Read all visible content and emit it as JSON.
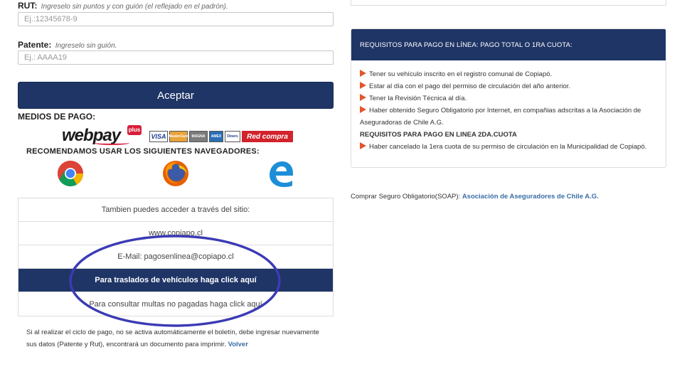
{
  "form": {
    "rut_label": "RUT:",
    "rut_hint": "Ingreselo sin puntos y con guión (el reflejado en el padrón).",
    "rut_placeholder": "Ej.:12345678-9",
    "patente_label": "Patente:",
    "patente_hint": "Ingreselo sin guión.",
    "patente_placeholder": "Ej.: AAAA19",
    "accept_label": "Aceptar"
  },
  "payment": {
    "title": "MEDIOS DE PAGO:",
    "webpay_web": "web",
    "webpay_pay": "pay",
    "webpay_plus": "plus",
    "cards": [
      "VISA",
      "MasterCard",
      "MAGNA",
      "AMEX",
      "Diners",
      "Red compra"
    ]
  },
  "browsers": {
    "title": "RECOMENDAMOS USAR LOS SIGUIENTES NAVEGADORES:",
    "icons": [
      "chrome-icon",
      "firefox-icon",
      "edge-icon"
    ]
  },
  "info": {
    "access_text": "Tambien puedes acceder a través del sitio:",
    "site": "www.copiapo.cl",
    "email": "E-Mail: pagosenlinea@copiapo.cl",
    "traslados": "Para traslados de vehículos haga click aquí",
    "multas": "Para consultar multas no pagadas haga click aquí"
  },
  "note": {
    "text": "Si al realizar el ciclo de pago, no se activa automáticamente el boletín, debe ingresar nuevamente sus datos (Patente y Rut), encontrará un documento para imprimir.",
    "link": "Volver"
  },
  "requirements": {
    "header": "REQUISITOS PARA PAGO EN LÍNEA: PAGO TOTAL O 1RA CUOTA:",
    "items": [
      "Tener su vehículo inscrito en el registro comunal de Copiapó.",
      "Estar al día con el pago del permiso de circulación del año anterior.",
      "Tener la Revisión Técnica al día.",
      "Haber obtenido Seguro Obligatorio por Internet, en compañias adscritas a la Asociación de Aseguradoras de Chile A.G."
    ],
    "second_title": "REQUISITOS PARA PAGO EN LINEA 2DA.CUOTA",
    "second_items": [
      "Haber cancelado la 1era cuota de su permiso de circulación en la Municipalidad de Copiapó."
    ]
  },
  "soap": {
    "text": "Comprar Seguro Obligatorio(SOAP):",
    "link": "Asociación de Aseguradores de Chile A.G."
  },
  "colors": {
    "navy": "#1f3566",
    "arrow": "#e2562b",
    "annotation": "#3b3bb5",
    "link": "#3a6ea5"
  }
}
